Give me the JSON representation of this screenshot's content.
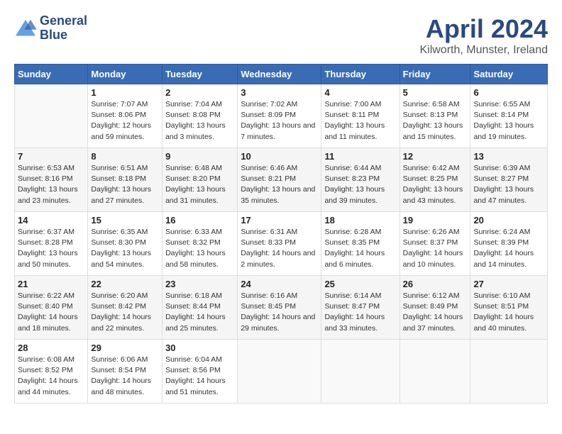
{
  "header": {
    "logo_line1": "General",
    "logo_line2": "Blue",
    "month_title": "April 2024",
    "location": "Kilworth, Munster, Ireland"
  },
  "weekdays": [
    "Sunday",
    "Monday",
    "Tuesday",
    "Wednesday",
    "Thursday",
    "Friday",
    "Saturday"
  ],
  "weeks": [
    [
      {
        "day": "",
        "sunrise": "",
        "sunset": "",
        "daylight": ""
      },
      {
        "day": "1",
        "sunrise": "Sunrise: 7:07 AM",
        "sunset": "Sunset: 8:06 PM",
        "daylight": "Daylight: 12 hours and 59 minutes."
      },
      {
        "day": "2",
        "sunrise": "Sunrise: 7:04 AM",
        "sunset": "Sunset: 8:08 PM",
        "daylight": "Daylight: 13 hours and 3 minutes."
      },
      {
        "day": "3",
        "sunrise": "Sunrise: 7:02 AM",
        "sunset": "Sunset: 8:09 PM",
        "daylight": "Daylight: 13 hours and 7 minutes."
      },
      {
        "day": "4",
        "sunrise": "Sunrise: 7:00 AM",
        "sunset": "Sunset: 8:11 PM",
        "daylight": "Daylight: 13 hours and 11 minutes."
      },
      {
        "day": "5",
        "sunrise": "Sunrise: 6:58 AM",
        "sunset": "Sunset: 8:13 PM",
        "daylight": "Daylight: 13 hours and 15 minutes."
      },
      {
        "day": "6",
        "sunrise": "Sunrise: 6:55 AM",
        "sunset": "Sunset: 8:14 PM",
        "daylight": "Daylight: 13 hours and 19 minutes."
      }
    ],
    [
      {
        "day": "7",
        "sunrise": "Sunrise: 6:53 AM",
        "sunset": "Sunset: 8:16 PM",
        "daylight": "Daylight: 13 hours and 23 minutes."
      },
      {
        "day": "8",
        "sunrise": "Sunrise: 6:51 AM",
        "sunset": "Sunset: 8:18 PM",
        "daylight": "Daylight: 13 hours and 27 minutes."
      },
      {
        "day": "9",
        "sunrise": "Sunrise: 6:48 AM",
        "sunset": "Sunset: 8:20 PM",
        "daylight": "Daylight: 13 hours and 31 minutes."
      },
      {
        "day": "10",
        "sunrise": "Sunrise: 6:46 AM",
        "sunset": "Sunset: 8:21 PM",
        "daylight": "Daylight: 13 hours and 35 minutes."
      },
      {
        "day": "11",
        "sunrise": "Sunrise: 6:44 AM",
        "sunset": "Sunset: 8:23 PM",
        "daylight": "Daylight: 13 hours and 39 minutes."
      },
      {
        "day": "12",
        "sunrise": "Sunrise: 6:42 AM",
        "sunset": "Sunset: 8:25 PM",
        "daylight": "Daylight: 13 hours and 43 minutes."
      },
      {
        "day": "13",
        "sunrise": "Sunrise: 6:39 AM",
        "sunset": "Sunset: 8:27 PM",
        "daylight": "Daylight: 13 hours and 47 minutes."
      }
    ],
    [
      {
        "day": "14",
        "sunrise": "Sunrise: 6:37 AM",
        "sunset": "Sunset: 8:28 PM",
        "daylight": "Daylight: 13 hours and 50 minutes."
      },
      {
        "day": "15",
        "sunrise": "Sunrise: 6:35 AM",
        "sunset": "Sunset: 8:30 PM",
        "daylight": "Daylight: 13 hours and 54 minutes."
      },
      {
        "day": "16",
        "sunrise": "Sunrise: 6:33 AM",
        "sunset": "Sunset: 8:32 PM",
        "daylight": "Daylight: 13 hours and 58 minutes."
      },
      {
        "day": "17",
        "sunrise": "Sunrise: 6:31 AM",
        "sunset": "Sunset: 8:33 PM",
        "daylight": "Daylight: 14 hours and 2 minutes."
      },
      {
        "day": "18",
        "sunrise": "Sunrise: 6:28 AM",
        "sunset": "Sunset: 8:35 PM",
        "daylight": "Daylight: 14 hours and 6 minutes."
      },
      {
        "day": "19",
        "sunrise": "Sunrise: 6:26 AM",
        "sunset": "Sunset: 8:37 PM",
        "daylight": "Daylight: 14 hours and 10 minutes."
      },
      {
        "day": "20",
        "sunrise": "Sunrise: 6:24 AM",
        "sunset": "Sunset: 8:39 PM",
        "daylight": "Daylight: 14 hours and 14 minutes."
      }
    ],
    [
      {
        "day": "21",
        "sunrise": "Sunrise: 6:22 AM",
        "sunset": "Sunset: 8:40 PM",
        "daylight": "Daylight: 14 hours and 18 minutes."
      },
      {
        "day": "22",
        "sunrise": "Sunrise: 6:20 AM",
        "sunset": "Sunset: 8:42 PM",
        "daylight": "Daylight: 14 hours and 22 minutes."
      },
      {
        "day": "23",
        "sunrise": "Sunrise: 6:18 AM",
        "sunset": "Sunset: 8:44 PM",
        "daylight": "Daylight: 14 hours and 25 minutes."
      },
      {
        "day": "24",
        "sunrise": "Sunrise: 6:16 AM",
        "sunset": "Sunset: 8:45 PM",
        "daylight": "Daylight: 14 hours and 29 minutes."
      },
      {
        "day": "25",
        "sunrise": "Sunrise: 6:14 AM",
        "sunset": "Sunset: 8:47 PM",
        "daylight": "Daylight: 14 hours and 33 minutes."
      },
      {
        "day": "26",
        "sunrise": "Sunrise: 6:12 AM",
        "sunset": "Sunset: 8:49 PM",
        "daylight": "Daylight: 14 hours and 37 minutes."
      },
      {
        "day": "27",
        "sunrise": "Sunrise: 6:10 AM",
        "sunset": "Sunset: 8:51 PM",
        "daylight": "Daylight: 14 hours and 40 minutes."
      }
    ],
    [
      {
        "day": "28",
        "sunrise": "Sunrise: 6:08 AM",
        "sunset": "Sunset: 8:52 PM",
        "daylight": "Daylight: 14 hours and 44 minutes."
      },
      {
        "day": "29",
        "sunrise": "Sunrise: 6:06 AM",
        "sunset": "Sunset: 8:54 PM",
        "daylight": "Daylight: 14 hours and 48 minutes."
      },
      {
        "day": "30",
        "sunrise": "Sunrise: 6:04 AM",
        "sunset": "Sunset: 8:56 PM",
        "daylight": "Daylight: 14 hours and 51 minutes."
      },
      {
        "day": "",
        "sunrise": "",
        "sunset": "",
        "daylight": ""
      },
      {
        "day": "",
        "sunrise": "",
        "sunset": "",
        "daylight": ""
      },
      {
        "day": "",
        "sunrise": "",
        "sunset": "",
        "daylight": ""
      },
      {
        "day": "",
        "sunrise": "",
        "sunset": "",
        "daylight": ""
      }
    ]
  ]
}
